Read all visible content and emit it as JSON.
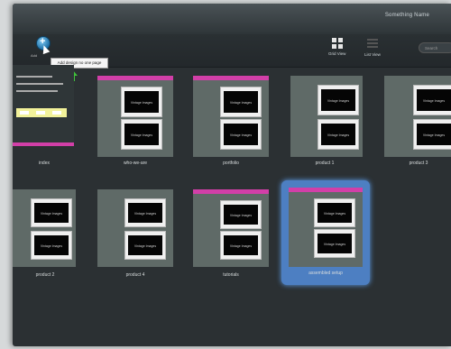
{
  "header": {
    "user_label": "Something Name"
  },
  "toolbar": {
    "add_label": "Add",
    "tooltip": "Add design no one page",
    "views": [
      {
        "label": "Grid View"
      },
      {
        "label": "List View"
      }
    ],
    "search_placeholder": "Search"
  },
  "pages": [
    {
      "name": "index"
    },
    {
      "name": "who-we-are"
    },
    {
      "name": "portfolio"
    },
    {
      "name": "product 1"
    },
    {
      "name": "product 2"
    },
    {
      "name": "product 3"
    },
    {
      "name": "product 4"
    },
    {
      "name": "tutorials"
    },
    {
      "name": "assembled setup"
    }
  ],
  "page_thumbnail_text": "Vintage Images"
}
